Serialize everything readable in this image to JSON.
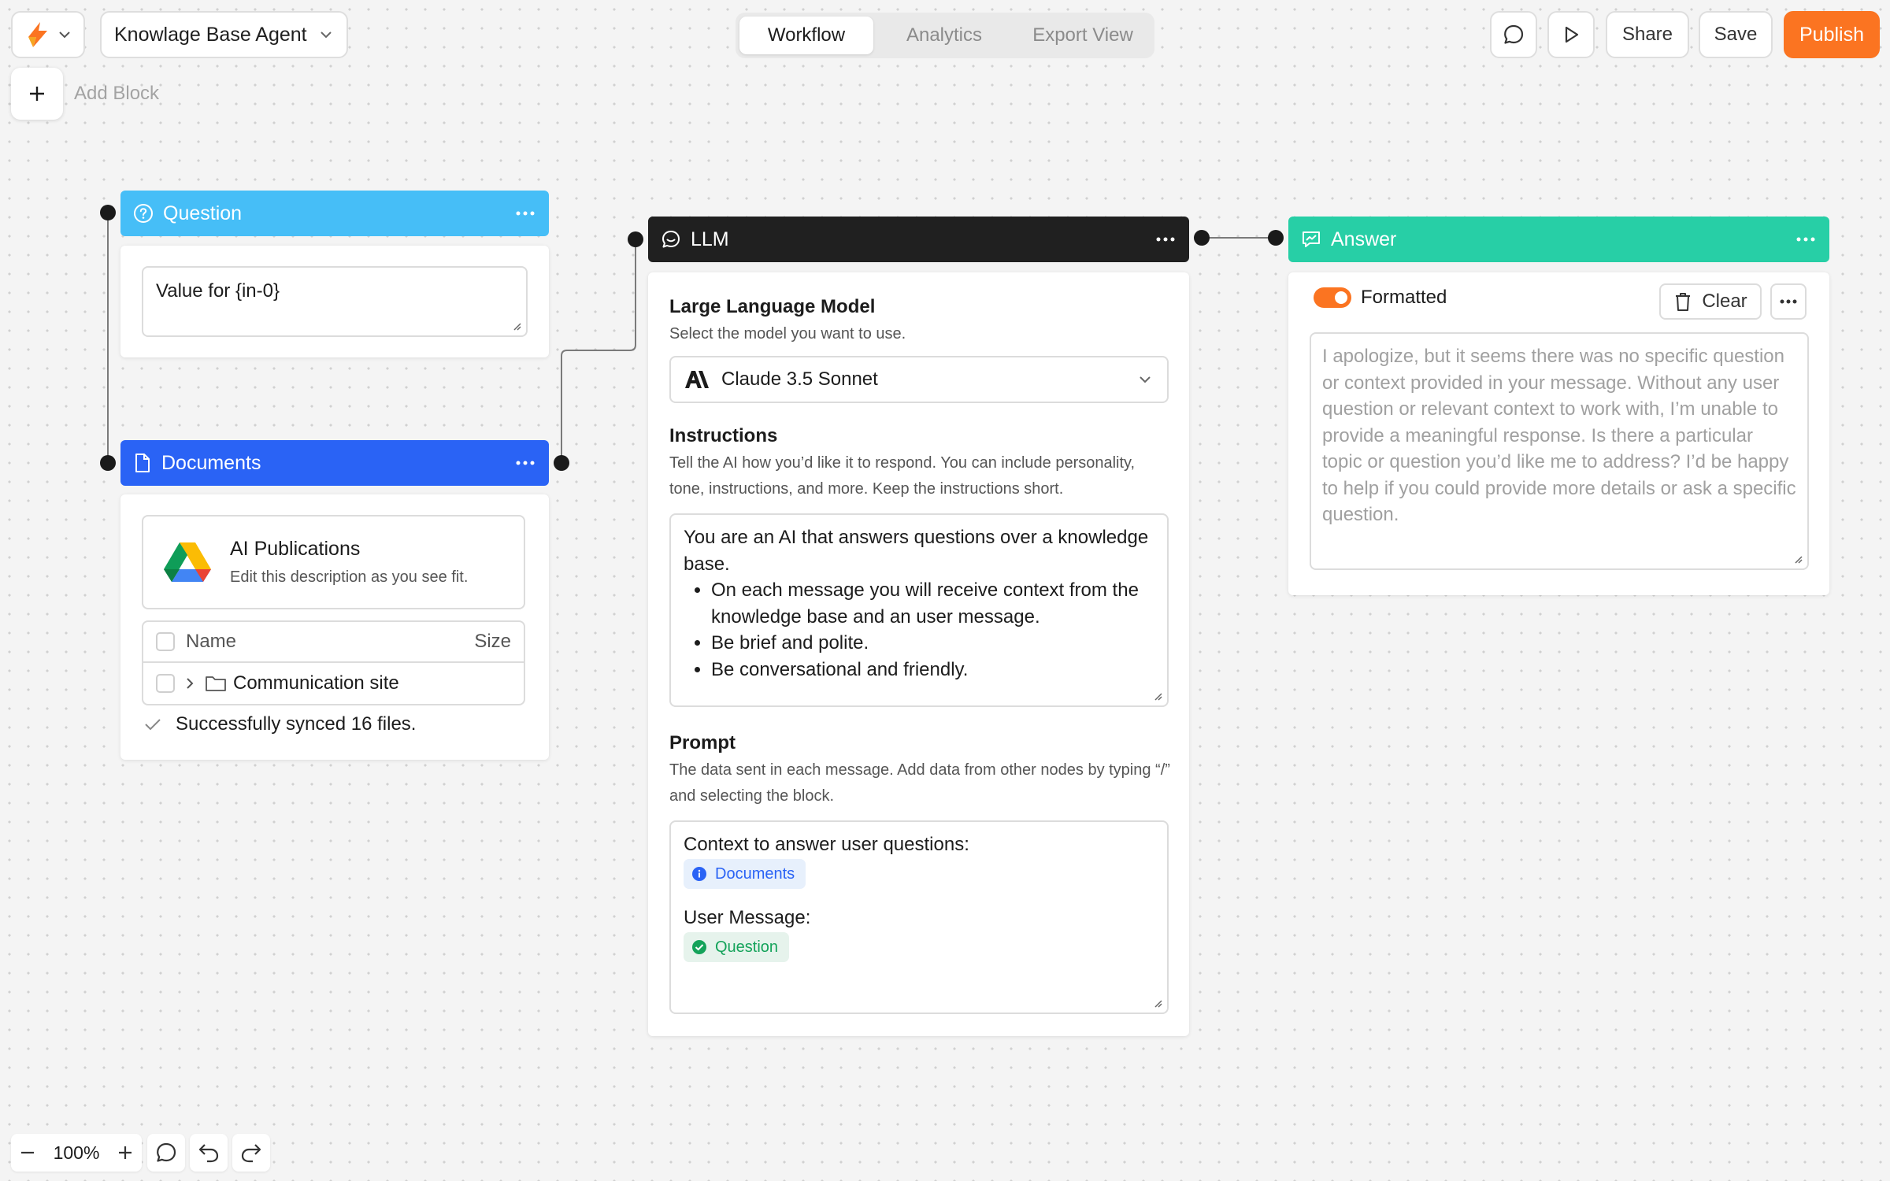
{
  "header": {
    "project_name": "Knowlage Base Agent",
    "tabs": [
      {
        "label": "Workflow",
        "active": true
      },
      {
        "label": "Analytics",
        "active": false
      },
      {
        "label": "Export View",
        "active": false
      }
    ],
    "share_label": "Share",
    "save_label": "Save",
    "publish_label": "Publish"
  },
  "toolbar": {
    "add_block_label": "Add Block"
  },
  "nodes": {
    "question": {
      "title": "Question",
      "input_value": "Value for {in-0}"
    },
    "documents": {
      "title": "Documents",
      "source_title": "AI Publications",
      "source_description": "Edit this description as you see fit.",
      "table_headers": {
        "name": "Name",
        "size": "Size"
      },
      "rows": [
        {
          "name": "Communication site"
        }
      ],
      "status": "Successfully synced 16 files."
    },
    "llm": {
      "title": "LLM",
      "model_section_title": "Large Language Model",
      "model_section_desc": "Select the model you want to use.",
      "model_selected": "Claude 3.5 Sonnet",
      "instructions_title": "Instructions",
      "instructions_desc": "Tell the AI how you’d like it to respond. You can include personality, tone, instructions, and more. Keep the instructions short.",
      "instructions_intro": "You are an AI that answers questions over a knowledge base.",
      "instructions_bullets": [
        "On each message you will receive context from the knowledge base and an user message.",
        "Be brief and polite.",
        "Be conversational and friendly."
      ],
      "prompt_title": "Prompt",
      "prompt_desc": "The data sent in each message. Add data from other nodes by typing “/” and selecting the block.",
      "prompt_context_label": "Context to answer user questions:",
      "prompt_context_chip": "Documents",
      "prompt_user_label": "User Message:",
      "prompt_user_chip": "Question"
    },
    "answer": {
      "title": "Answer",
      "toggle_label": "Formatted",
      "toggle_on": true,
      "clear_label": "Clear",
      "output_text": "I apologize, but it seems there was no specific question or context provided in your message. Without any user question or relevant context to work with, I’m unable to provide a meaningful response. Is there a particular topic or question you’d like me to address? I’d be happy to help if you could provide more details or ask a specific question."
    }
  },
  "footer": {
    "zoom": "100%"
  },
  "colors": {
    "question": "#46bef7",
    "documents": "#2a63f5",
    "llm": "#202020",
    "answer": "#27cfa6",
    "publish": "#fb7421"
  }
}
